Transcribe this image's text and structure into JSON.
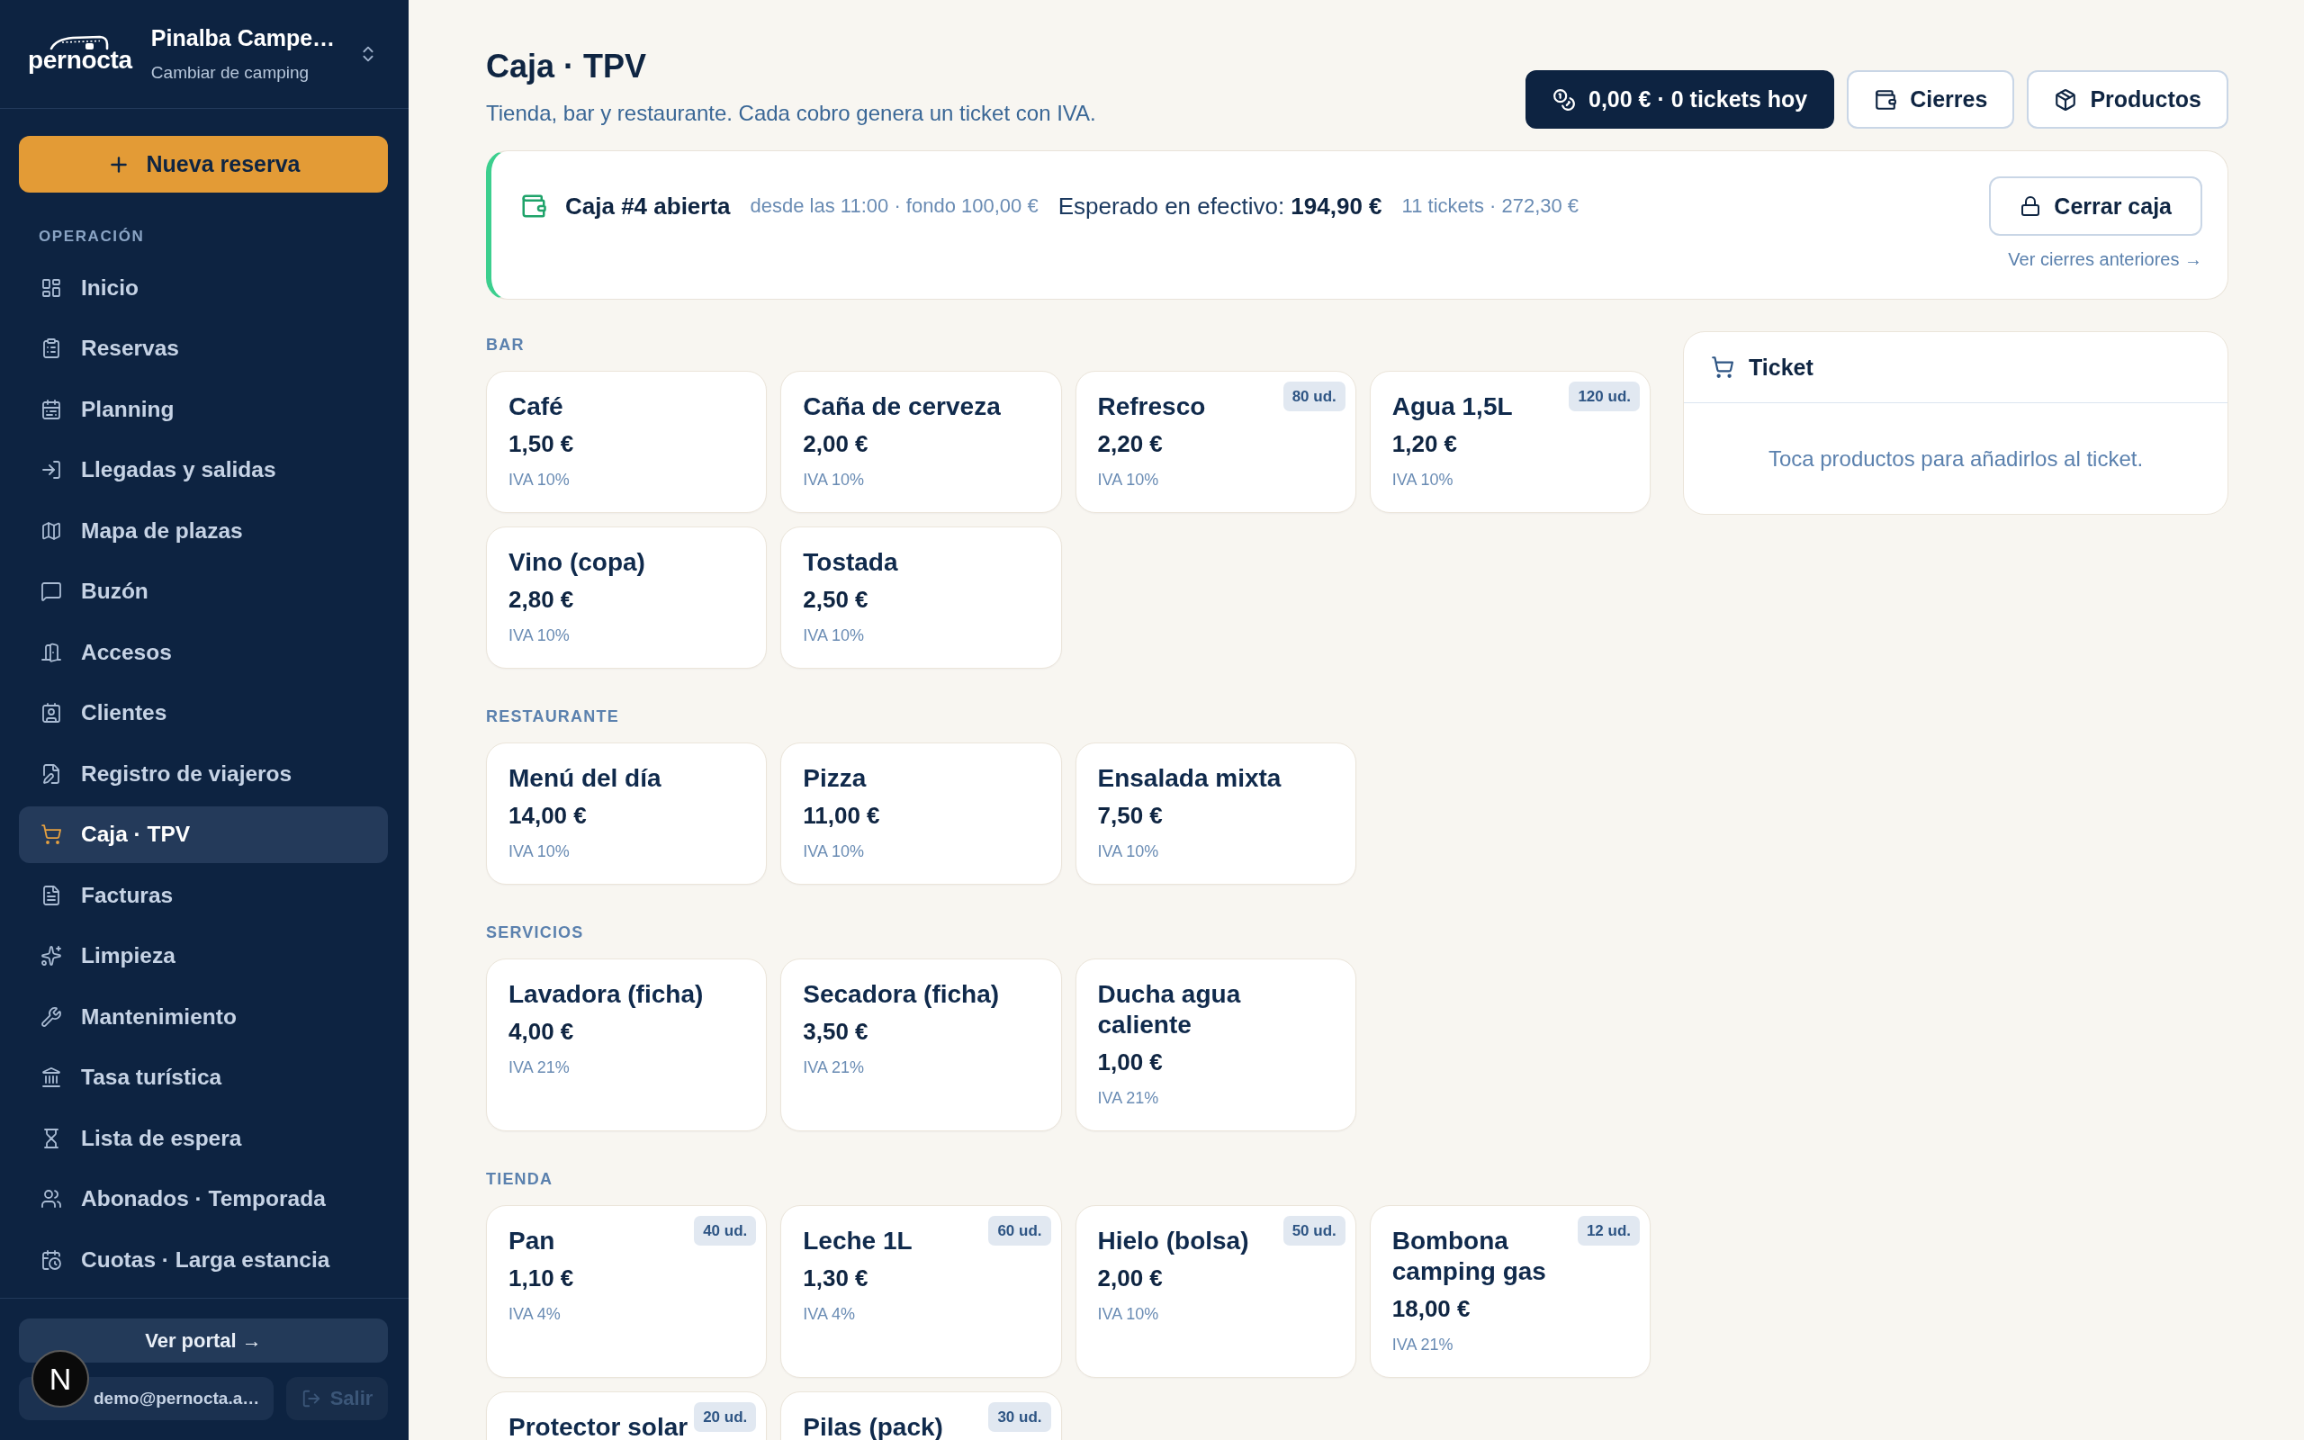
{
  "sidebar": {
    "brand": "pernocta",
    "camping": {
      "name": "Pinalba Campe…",
      "subtitle": "Cambiar de camping"
    },
    "new_button": "Nueva reserva",
    "section_label": "OPERACIÓN",
    "items": [
      {
        "label": "Inicio",
        "selected": false
      },
      {
        "label": "Reservas",
        "selected": false
      },
      {
        "label": "Planning",
        "selected": false
      },
      {
        "label": "Llegadas y salidas",
        "selected": false
      },
      {
        "label": "Mapa de plazas",
        "selected": false
      },
      {
        "label": "Buzón",
        "selected": false
      },
      {
        "label": "Accesos",
        "selected": false
      },
      {
        "label": "Clientes",
        "selected": false
      },
      {
        "label": "Registro de viajeros",
        "selected": false
      },
      {
        "label": "Caja · TPV",
        "selected": true
      },
      {
        "label": "Facturas",
        "selected": false
      },
      {
        "label": "Limpieza",
        "selected": false
      },
      {
        "label": "Mantenimiento",
        "selected": false
      },
      {
        "label": "Tasa turística",
        "selected": false
      },
      {
        "label": "Lista de espera",
        "selected": false
      },
      {
        "label": "Abonados · Temporada",
        "selected": false
      },
      {
        "label": "Cuotas · Larga estancia",
        "selected": false
      }
    ],
    "portal_button": "Ver portal →",
    "user_button": "demo@pernocta.a…",
    "logout_button": "Salir"
  },
  "dev_badge": {
    "label": "N"
  },
  "header": {
    "title": "Caja · TPV",
    "subtitle": "Tienda, bar y restaurante. Cada cobro genera un ticket con IVA.",
    "summary_button": "0,00 € · 0 tickets hoy",
    "buttons": [
      "Cierres",
      "Productos"
    ]
  },
  "register": {
    "open": true,
    "name": "Caja #4 abierta",
    "meta": "desde las 11:00 · fondo 100,00 €",
    "expected": "Esperado en efectivo: **194,90 €**",
    "totals": "11 tickets · 272,30 €",
    "close_button": "Cerrar caja",
    "history_link": "Ver cierres anteriores →"
  },
  "catalog": [
    {
      "title": "BAR",
      "products": [
        {
          "name": "Café",
          "price": "1,50 €",
          "tax": "IVA 10%"
        },
        {
          "name": "Caña de cerveza",
          "price": "2,00 €",
          "tax": "IVA 10%"
        },
        {
          "name": "Refresco",
          "price": "2,20 €",
          "tax": "IVA 10%",
          "stock": "80 ud."
        },
        {
          "name": "Agua 1,5L",
          "price": "1,20 €",
          "tax": "IVA 10%",
          "stock": "120 ud."
        },
        {
          "name": "Vino (copa)",
          "price": "2,80 €",
          "tax": "IVA 10%"
        },
        {
          "name": "Tostada",
          "price": "2,50 €",
          "tax": "IVA 10%"
        }
      ]
    },
    {
      "title": "RESTAURANTE",
      "products": [
        {
          "name": "Menú del día",
          "price": "14,00 €",
          "tax": "IVA 10%"
        },
        {
          "name": "Pizza",
          "price": "11,00 €",
          "tax": "IVA 10%"
        },
        {
          "name": "Ensalada mixta",
          "price": "7,50 €",
          "tax": "IVA 10%"
        }
      ]
    },
    {
      "title": "SERVICIOS",
      "products": [
        {
          "name": "Lavadora (ficha)",
          "price": "4,00 €",
          "tax": "IVA 21%"
        },
        {
          "name": "Secadora (ficha)",
          "price": "3,50 €",
          "tax": "IVA 21%"
        },
        {
          "name": "Ducha agua caliente",
          "price": "1,00 €",
          "tax": "IVA 21%"
        }
      ]
    },
    {
      "title": "TIENDA",
      "products": [
        {
          "name": "Pan",
          "price": "1,10 €",
          "tax": "IVA 4%",
          "stock": "40 ud."
        },
        {
          "name": "Leche 1L",
          "price": "1,30 €",
          "tax": "IVA 4%",
          "stock": "60 ud."
        },
        {
          "name": "Hielo (bolsa)",
          "price": "2,00 €",
          "tax": "IVA 10%",
          "stock": "50 ud."
        },
        {
          "name": "Bombona camping gas",
          "price": "18,00 €",
          "tax": "IVA 21%",
          "stock": "12 ud."
        },
        {
          "name": "Protector solar",
          "stock": "20 ud."
        },
        {
          "name": "Pilas (pack)",
          "stock": "30 ud."
        }
      ]
    }
  ],
  "ticket": {
    "title": "Ticket",
    "empty_message": "Toca productos para añadirlos al ticket."
  }
}
